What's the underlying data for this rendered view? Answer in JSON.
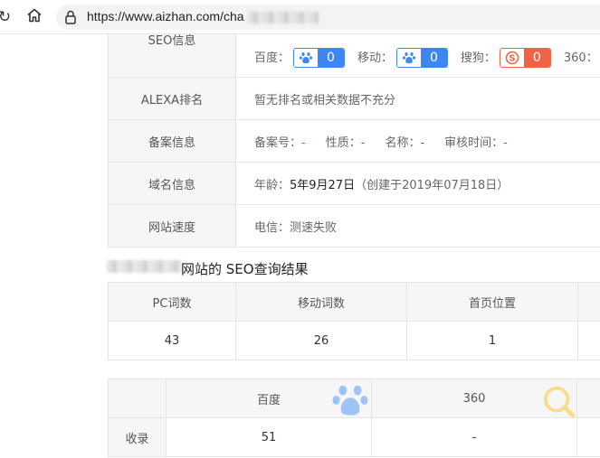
{
  "browser": {
    "url": "https://www.aizhan.com/cha"
  },
  "info_rows": [
    {
      "label": "SEO信息"
    },
    {
      "label": "ALEXA排名",
      "value": "暂无排名或相关数据不充分"
    },
    {
      "label": "备案信息"
    },
    {
      "label": "域名信息"
    },
    {
      "label": "网站速度",
      "value": "电信：测速失败"
    }
  ],
  "seo_info": {
    "baidu_label": "百度：",
    "baidu_value": "0",
    "mobile_label": "移动：",
    "mobile_value": "0",
    "sogou_label": "搜狗：",
    "sogou_value": "0",
    "s360_label": "360："
  },
  "beian": {
    "no_label": "备案号：",
    "no_value": "-",
    "nature_label": "性质：",
    "nature_value": "-",
    "name_label": "名称：",
    "name_value": "-",
    "time_label": "审核时间：",
    "time_value": "-"
  },
  "domain": {
    "age_label": "年龄：",
    "age_value": "5年9月27日",
    "created": "（创建于2019年07月18日）"
  },
  "seo_result": {
    "title_suffix": "网站的 SEO查询结果",
    "headers": [
      "PC词数",
      "移动词数",
      "首页位置"
    ],
    "values": [
      "43",
      "26",
      "1"
    ]
  },
  "records": {
    "headers": [
      "百度",
      "360"
    ],
    "row_label": "收录",
    "values": [
      "51",
      "-"
    ]
  }
}
